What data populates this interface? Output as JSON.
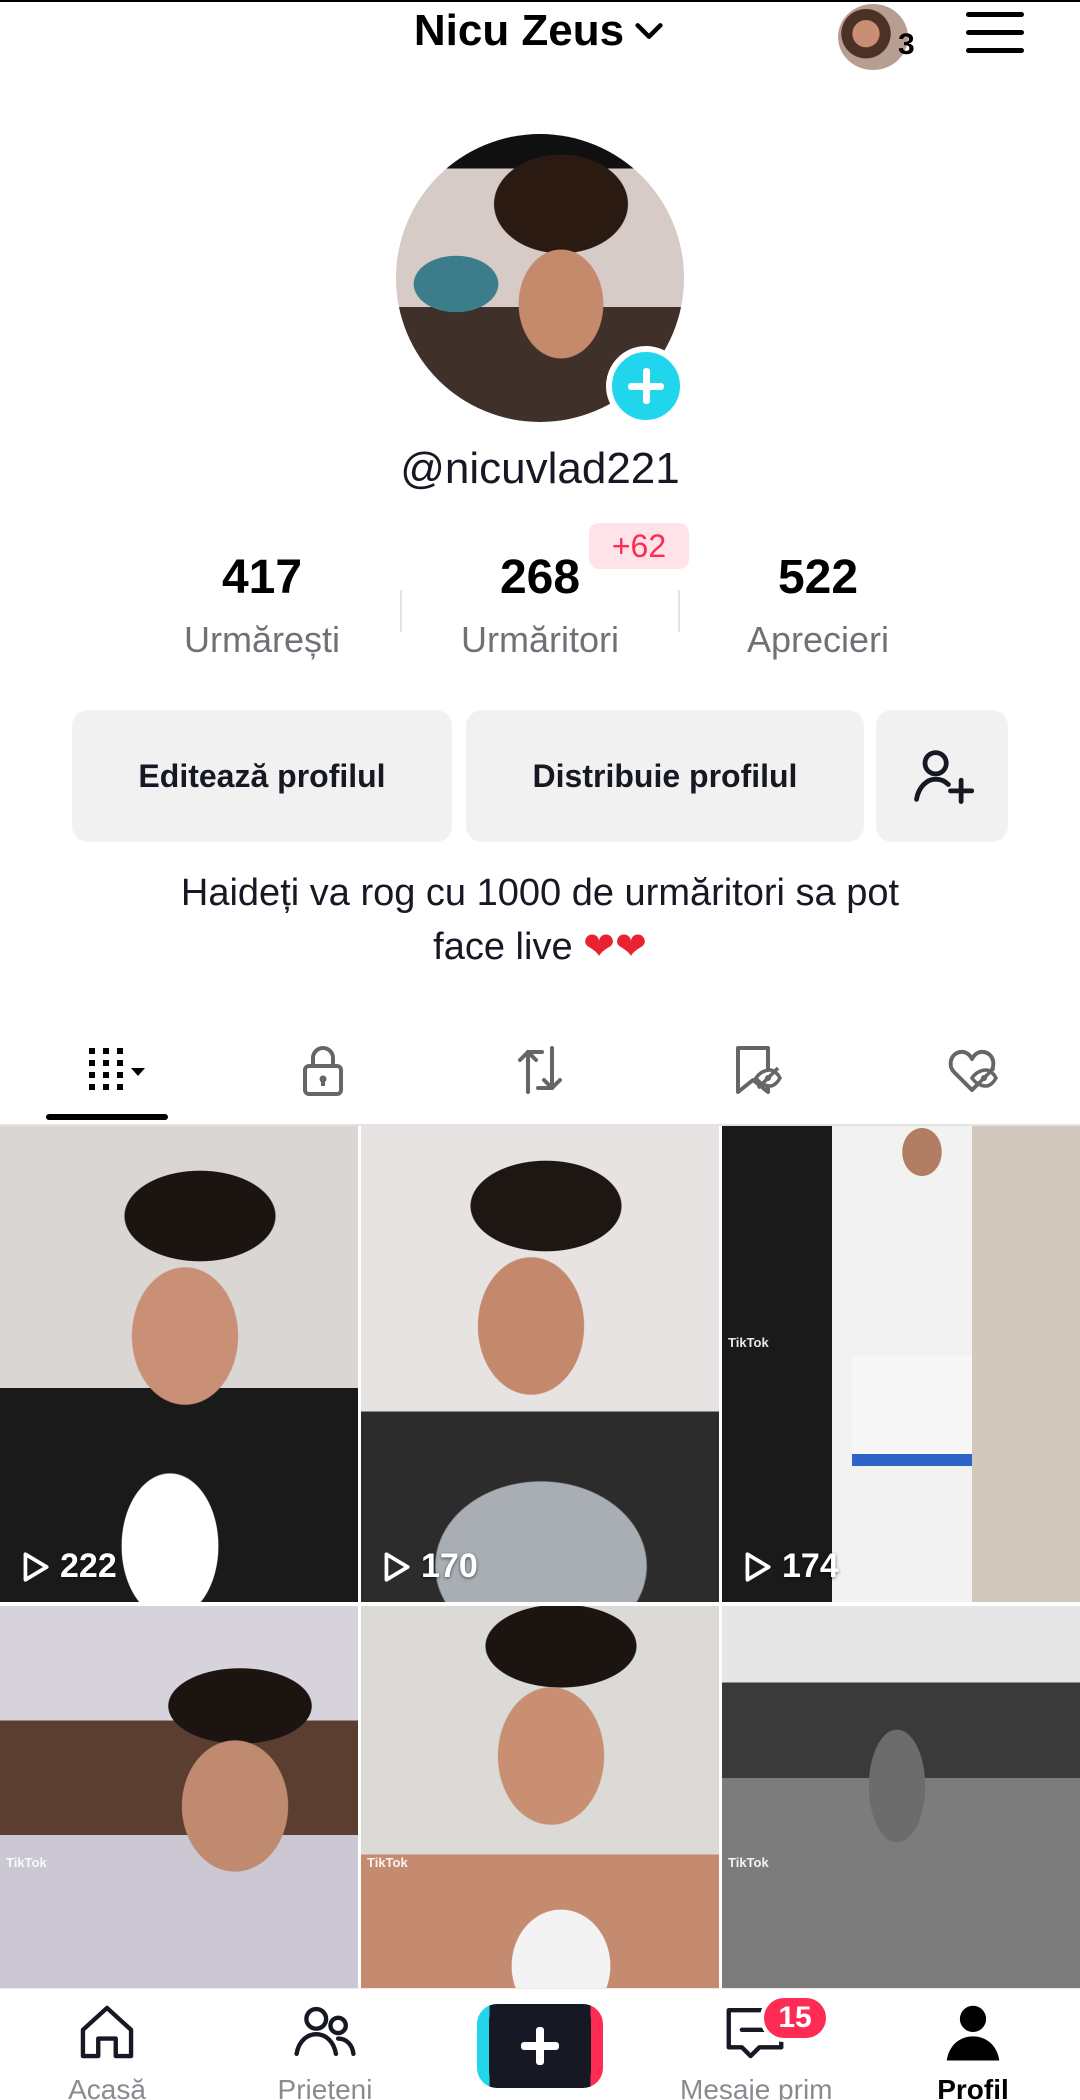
{
  "header": {
    "title": "Nicu Zeus",
    "account_count": "3",
    "icons": [
      "chevron-down-icon",
      "menu-icon"
    ]
  },
  "profile": {
    "username": "@nicuvlad221",
    "stats": [
      {
        "value": "417",
        "label": "Urmărești"
      },
      {
        "value": "268",
        "label": "Urmăritori",
        "badge": "+62"
      },
      {
        "value": "522",
        "label": "Aprecieri"
      }
    ],
    "buttons": {
      "edit": "Editează profilul",
      "share": "Distribuie profilul",
      "add_friend_icon": "add-user-icon"
    },
    "bio_line1": "Haideți va rog cu 1000 de urmăritori sa pot",
    "bio_line2": "face live",
    "bio_emoji": "❤❤"
  },
  "tabs": [
    {
      "icon": "grid-icon",
      "active": true
    },
    {
      "icon": "lock-icon"
    },
    {
      "icon": "repost-icon"
    },
    {
      "icon": "saved-icon"
    },
    {
      "icon": "liked-icon"
    }
  ],
  "videos": [
    {
      "views": "222"
    },
    {
      "views": "170"
    },
    {
      "views": "174",
      "watermark": "TikTok"
    },
    {
      "views": "",
      "watermark": "TikTok"
    },
    {
      "views": "",
      "watermark": "TikTok"
    },
    {
      "views": "",
      "watermark": "TikTok"
    }
  ],
  "nav": {
    "home": "Acasă",
    "friends": "Prieteni",
    "inbox": "Mesaje prim",
    "inbox_badge": "15",
    "profile": "Profil"
  },
  "colors": {
    "accent_red": "#fe2c55",
    "accent_cyan": "#20d5ec",
    "button_bg": "#f1f1f2"
  }
}
